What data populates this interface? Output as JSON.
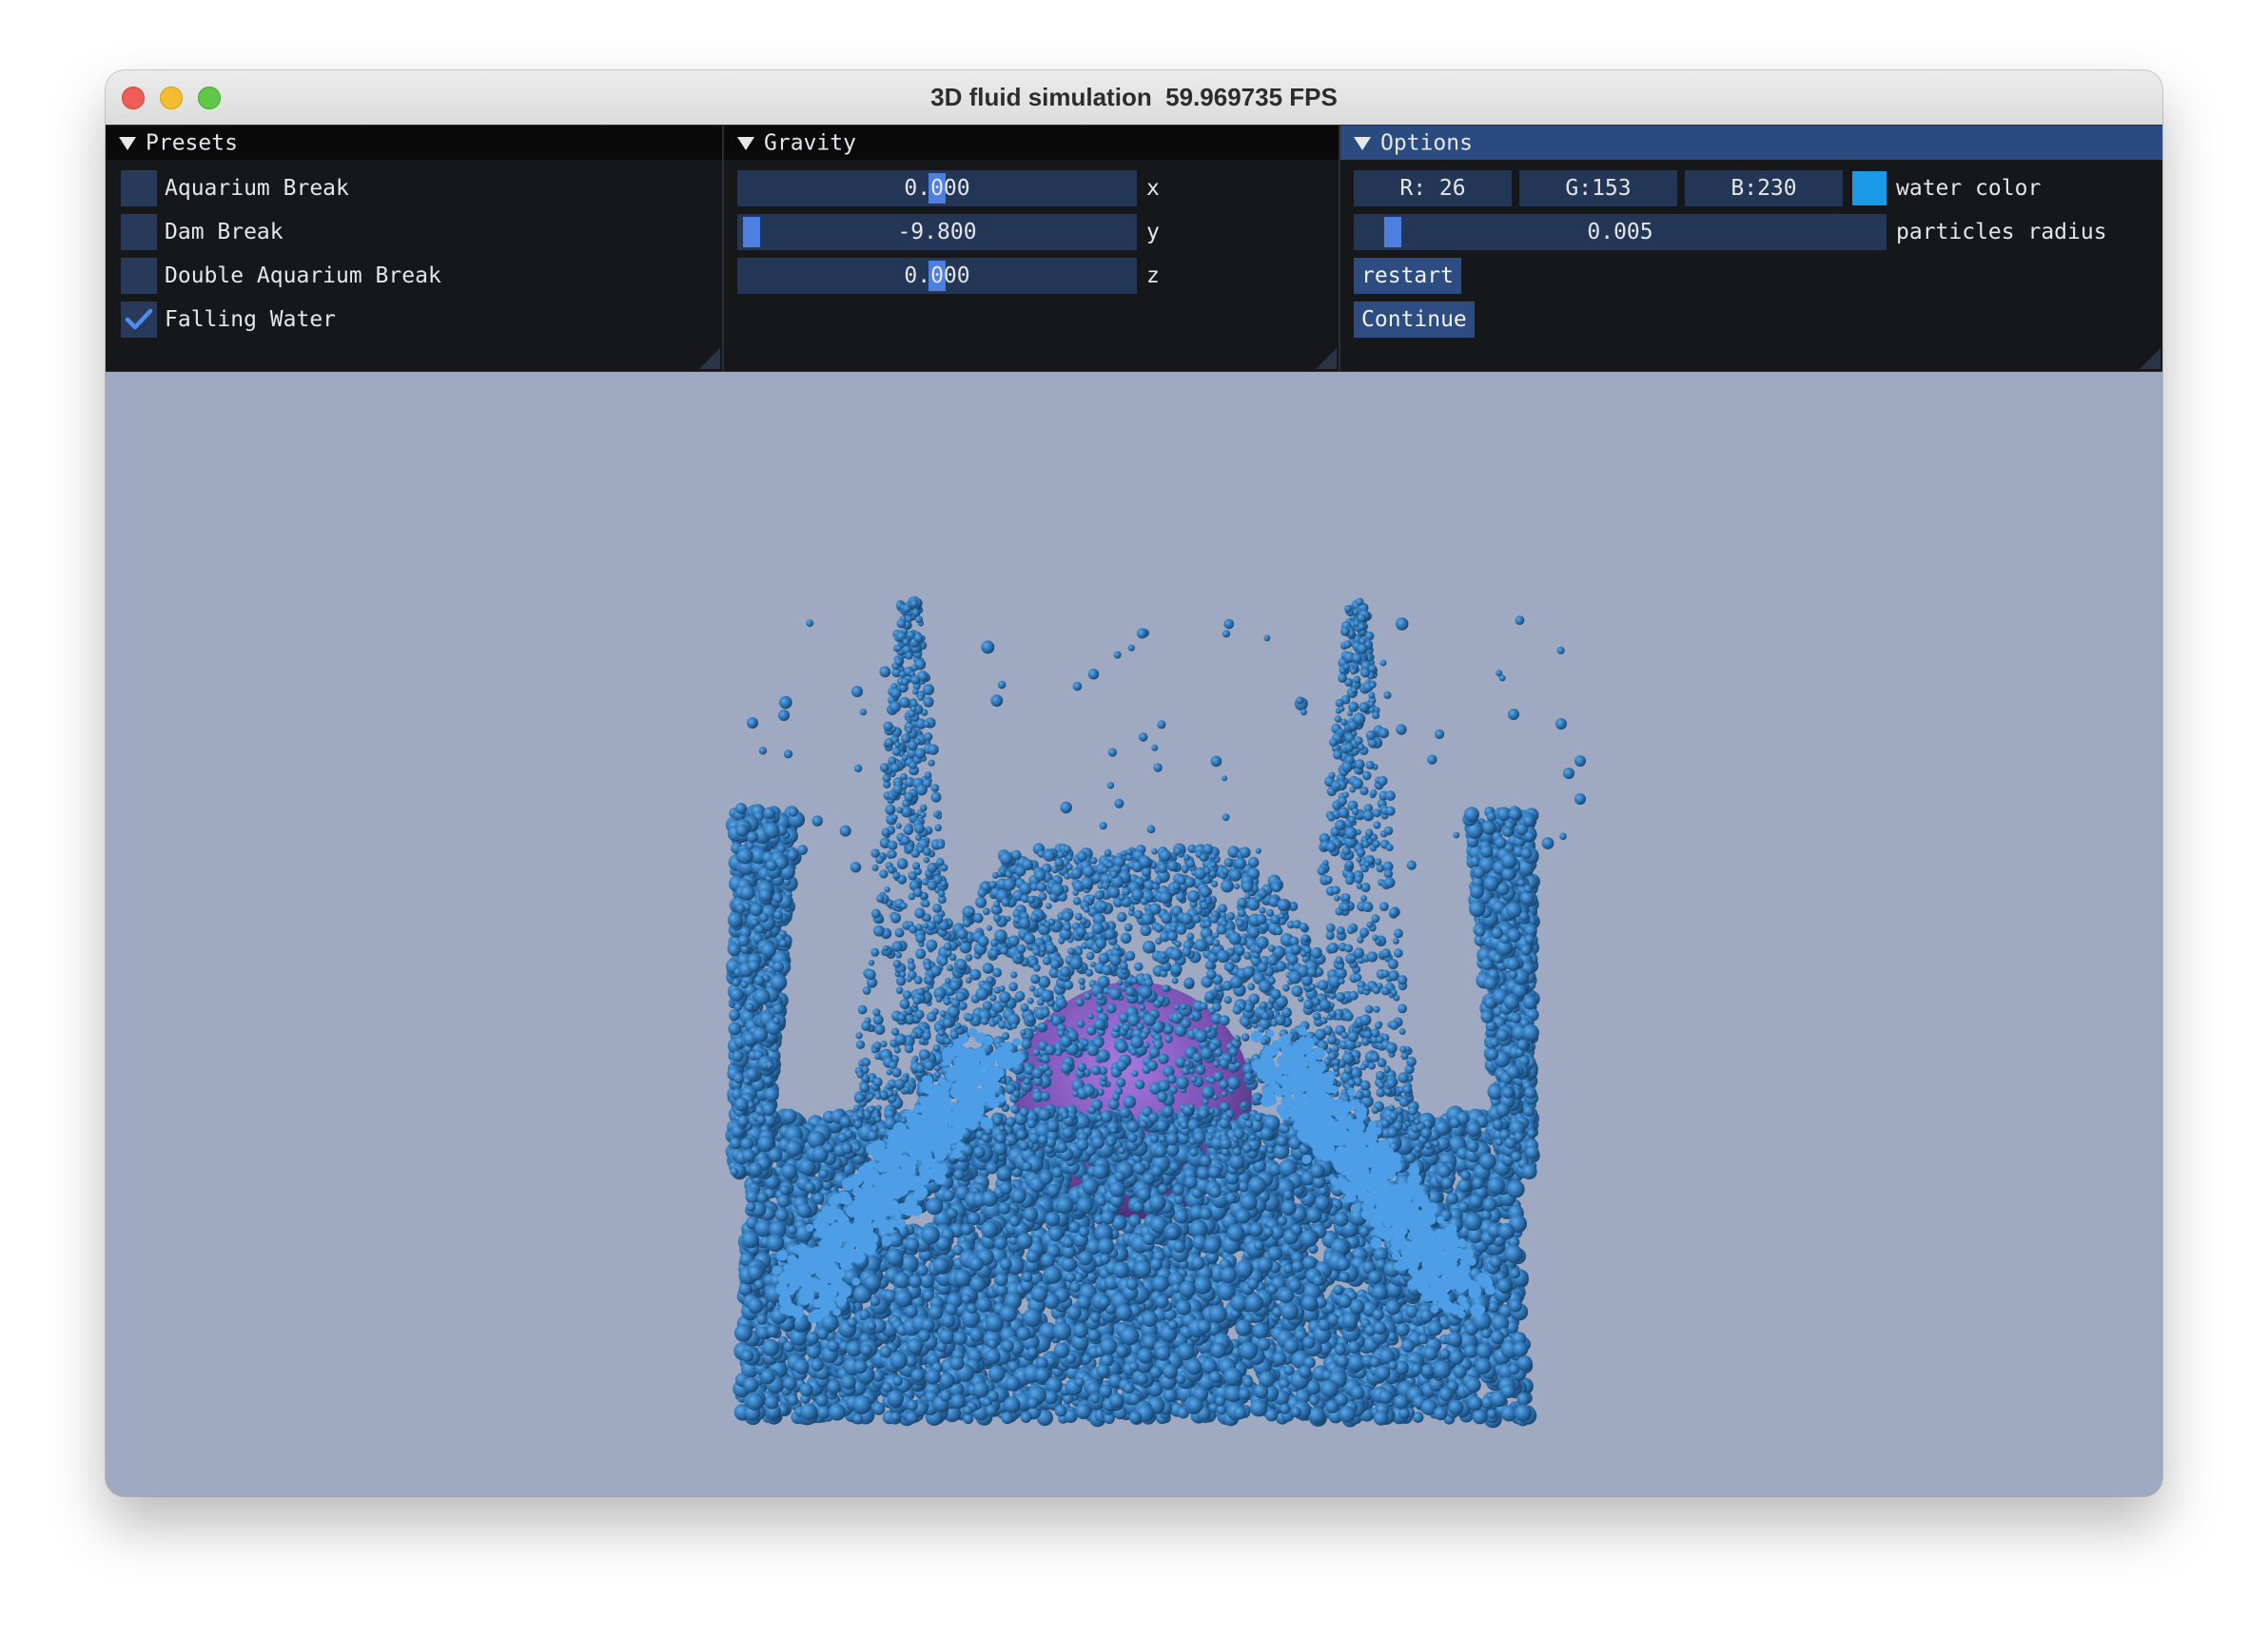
{
  "window": {
    "title": "3D fluid simulation  59.969735 FPS"
  },
  "presets": {
    "header": "Presets",
    "items": [
      {
        "label": "Aquarium Break",
        "checked": false
      },
      {
        "label": "Dam Break",
        "checked": false
      },
      {
        "label": "Double Aquarium Break",
        "checked": false
      },
      {
        "label": "Falling Water",
        "checked": true
      }
    ]
  },
  "gravity": {
    "header": "Gravity",
    "x": {
      "value": "0.000",
      "label": "x"
    },
    "y": {
      "value": "-9.800",
      "label": "y"
    },
    "z": {
      "value": "0.000",
      "label": "z"
    }
  },
  "options": {
    "header": "Options",
    "color_r": "R: 26",
    "color_g": "G:153",
    "color_b": "B:230",
    "water_color_label": "water color",
    "radius_value": "0.005",
    "radius_label": "particles radius",
    "restart_label": "restart",
    "continue_label": "Continue"
  },
  "colors": {
    "water": "#1a99e6",
    "background": "#9fa9c1",
    "panel_bg": "#15171b",
    "accent": "#4c7fe0",
    "sphere": "#8a5fc4"
  }
}
